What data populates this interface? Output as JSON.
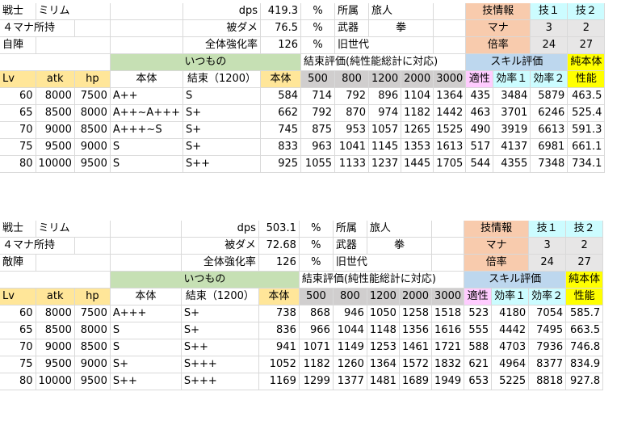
{
  "blocks": [
    {
      "info": {
        "class": "戦士",
        "name": "ミリム",
        "mana_hold": "４マナ所持",
        "side": "自陣",
        "dps_label": "dps",
        "dps": "419.3",
        "dmg_label": "被ダメ",
        "dmg": "76.5",
        "boost_label": "全体強化率",
        "boost": "126",
        "pct": "%",
        "affil_label": "所属",
        "affil": "旅人",
        "weapon_label": "武器",
        "weapon": "拳",
        "gen": "旧世代",
        "skill_info": "技情報",
        "skill1": "技１",
        "skill2": "技２",
        "mana_label": "マナ",
        "mana1": "3",
        "mana2": "2",
        "mult_label": "倍率",
        "mult1": "24",
        "mult2": "27"
      },
      "header": {
        "itsumono": "いつもの",
        "kessoku_eval": "結束評価(純性能総計に対応)",
        "skill_eval": "スキル評価",
        "pure_body": "純本体",
        "lv": "Lv",
        "atk": "atk",
        "hp": "hp",
        "body": "本体",
        "kessoku": "結束（1200）",
        "body2": "本体",
        "k500": "500",
        "k800": "800",
        "k1200": "1200",
        "k2000": "2000",
        "k3000": "3000",
        "aptitude": "適性",
        "eff1": "効率１",
        "eff2": "効率２",
        "performance": "性能"
      },
      "rows": [
        {
          "lv": "60",
          "atk": "8000",
          "hp": "7500",
          "body": "A++",
          "kessoku": "S",
          "body2": "584",
          "k500": "714",
          "k800": "792",
          "k1200": "896",
          "k2000": "1104",
          "k3000": "1364",
          "apt": "435",
          "eff1": "3484",
          "eff2": "5879",
          "perf": "463.5"
        },
        {
          "lv": "65",
          "atk": "8500",
          "hp": "8000",
          "body": "A++~A+++",
          "kessoku": "S+",
          "body2": "662",
          "k500": "792",
          "k800": "870",
          "k1200": "974",
          "k2000": "1182",
          "k3000": "1442",
          "apt": "463",
          "eff1": "3701",
          "eff2": "6246",
          "perf": "525.4"
        },
        {
          "lv": "70",
          "atk": "9000",
          "hp": "8500",
          "body": "A+++~S",
          "kessoku": "S+",
          "body2": "745",
          "k500": "875",
          "k800": "953",
          "k1200": "1057",
          "k2000": "1265",
          "k3000": "1525",
          "apt": "490",
          "eff1": "3919",
          "eff2": "6613",
          "perf": "591.3"
        },
        {
          "lv": "75",
          "atk": "9500",
          "hp": "9000",
          "body": "S",
          "kessoku": "S+",
          "body2": "833",
          "k500": "963",
          "k800": "1041",
          "k1200": "1145",
          "k2000": "1353",
          "k3000": "1613",
          "apt": "517",
          "eff1": "4137",
          "eff2": "6981",
          "perf": "661.1"
        },
        {
          "lv": "80",
          "atk": "10000",
          "hp": "9500",
          "body": "S",
          "kessoku": "S++",
          "body2": "925",
          "k500": "1055",
          "k800": "1133",
          "k1200": "1237",
          "k2000": "1445",
          "k3000": "1705",
          "apt": "544",
          "eff1": "4355",
          "eff2": "7348",
          "perf": "734.1"
        }
      ]
    },
    {
      "info": {
        "class": "戦士",
        "name": "ミリム",
        "mana_hold": "４マナ所持",
        "side": "敵陣",
        "dps_label": "dps",
        "dps": "503.1",
        "dmg_label": "被ダメ",
        "dmg": "72.68",
        "boost_label": "全体強化率",
        "boost": "126",
        "pct": "%",
        "affil_label": "所属",
        "affil": "旅人",
        "weapon_label": "武器",
        "weapon": "拳",
        "gen": "旧世代",
        "skill_info": "技情報",
        "skill1": "技１",
        "skill2": "技２",
        "mana_label": "マナ",
        "mana1": "3",
        "mana2": "2",
        "mult_label": "倍率",
        "mult1": "24",
        "mult2": "27"
      },
      "header": {
        "itsumono": "いつもの",
        "kessoku_eval": "結束評価(純性能総計に対応)",
        "skill_eval": "スキル評価",
        "pure_body": "純本体",
        "lv": "Lv",
        "atk": "atk",
        "hp": "hp",
        "body": "本体",
        "kessoku": "結束（1200）",
        "body2": "本体",
        "k500": "500",
        "k800": "800",
        "k1200": "1200",
        "k2000": "2000",
        "k3000": "3000",
        "aptitude": "適性",
        "eff1": "効率１",
        "eff2": "効率２",
        "performance": "性能"
      },
      "rows": [
        {
          "lv": "60",
          "atk": "8000",
          "hp": "7500",
          "body": "A+++",
          "kessoku": "S+",
          "body2": "738",
          "k500": "868",
          "k800": "946",
          "k1200": "1050",
          "k2000": "1258",
          "k3000": "1518",
          "apt": "523",
          "eff1": "4180",
          "eff2": "7054",
          "perf": "585.7"
        },
        {
          "lv": "65",
          "atk": "8500",
          "hp": "8000",
          "body": "S",
          "kessoku": "S+",
          "body2": "836",
          "k500": "966",
          "k800": "1044",
          "k1200": "1148",
          "k2000": "1356",
          "k3000": "1616",
          "apt": "555",
          "eff1": "4442",
          "eff2": "7495",
          "perf": "663.5"
        },
        {
          "lv": "70",
          "atk": "9000",
          "hp": "8500",
          "body": "S",
          "kessoku": "S++",
          "body2": "941",
          "k500": "1071",
          "k800": "1149",
          "k1200": "1253",
          "k2000": "1461",
          "k3000": "1721",
          "apt": "588",
          "eff1": "4703",
          "eff2": "7936",
          "perf": "746.8"
        },
        {
          "lv": "75",
          "atk": "9500",
          "hp": "9000",
          "body": "S+",
          "kessoku": "S+++",
          "body2": "1052",
          "k500": "1182",
          "k800": "1260",
          "k1200": "1364",
          "k2000": "1572",
          "k3000": "1832",
          "apt": "621",
          "eff1": "4964",
          "eff2": "8377",
          "perf": "834.9"
        },
        {
          "lv": "80",
          "atk": "10000",
          "hp": "9500",
          "body": "S++",
          "kessoku": "S+++",
          "body2": "1169",
          "k500": "1299",
          "k800": "1377",
          "k1200": "1481",
          "k2000": "1689",
          "k3000": "1949",
          "apt": "653",
          "eff1": "5225",
          "eff2": "8818",
          "perf": "927.8"
        }
      ]
    }
  ]
}
